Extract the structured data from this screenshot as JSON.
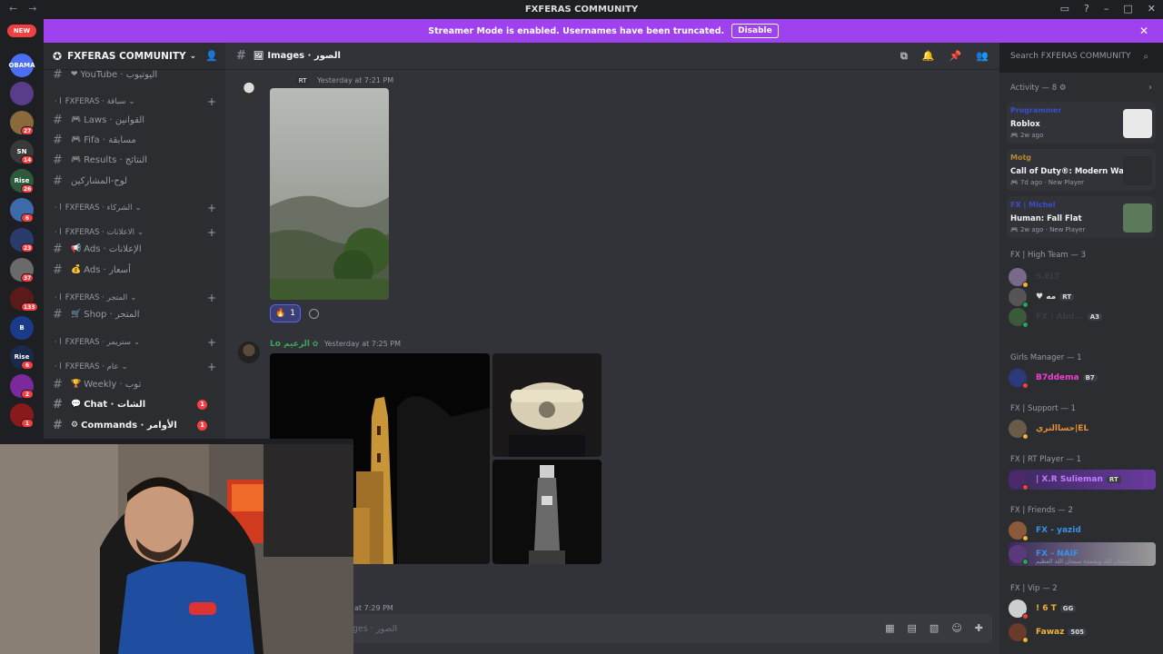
{
  "window": {
    "title": "FXFERAS COMMUNITY"
  },
  "banner": {
    "text": "Streamer Mode is enabled. Usernames have been truncated.",
    "disable_label": "Disable"
  },
  "servers": {
    "new_label": "NEW",
    "items": [
      {
        "name": "OBAMA",
        "color": "#4b6ef2",
        "badge": ""
      },
      {
        "name": "",
        "color": "#5a3d8a",
        "badge": ""
      },
      {
        "name": "",
        "color": "#8a6a3d",
        "badge": "27"
      },
      {
        "name": "SN",
        "color": "#3a3a3a",
        "badge": "14"
      },
      {
        "name": "Rise",
        "color": "#2d5a3d",
        "badge": "26"
      },
      {
        "name": "",
        "color": "#3d6aa8",
        "badge": "6"
      },
      {
        "name": "",
        "color": "#2a3a6a",
        "badge": "23"
      },
      {
        "name": "",
        "color": "#6a6a6a",
        "badge": "37"
      },
      {
        "name": "",
        "color": "#5a1a1a",
        "badge": "133"
      },
      {
        "name": "B",
        "color": "#1a3a8a",
        "badge": ""
      },
      {
        "name": "Rise",
        "color": "#1a2a4a",
        "badge": "6"
      },
      {
        "name": "",
        "color": "#7a2a9a",
        "badge": "2"
      },
      {
        "name": "",
        "color": "#8a1a1a",
        "badge": "1"
      }
    ]
  },
  "sidebar": {
    "guild_name": "FXFERAS COMMUNITY",
    "channels": [
      {
        "type": "channel",
        "emoji": "❤",
        "label": "YouTube · اليوتيوب",
        "bold": false,
        "unread": ""
      },
      {
        "type": "category",
        "label": "FXFERAS · سباقة"
      },
      {
        "type": "channel",
        "emoji": "🎮",
        "label": "Laws · القوانين",
        "bold": false,
        "unread": ""
      },
      {
        "type": "channel",
        "emoji": "🎮",
        "label": "Fifa · مسابقة",
        "bold": false,
        "unread": ""
      },
      {
        "type": "channel",
        "emoji": "🎮",
        "label": "Results · النتائج",
        "bold": false,
        "unread": ""
      },
      {
        "type": "channel",
        "emoji": "",
        "label": "لوح-المشاركين",
        "bold": false,
        "unread": ""
      },
      {
        "type": "category",
        "label": "FXFERAS · الشركاء"
      },
      {
        "type": "category",
        "label": "FXFERAS · الاعلانات"
      },
      {
        "type": "channel",
        "emoji": "📢",
        "label": "Ads · الإعلانات",
        "bold": false,
        "unread": ""
      },
      {
        "type": "channel",
        "emoji": "💰",
        "label": "Ads · أسعار",
        "bold": false,
        "unread": ""
      },
      {
        "type": "category",
        "label": "FXFERAS · المتجر"
      },
      {
        "type": "channel",
        "emoji": "🛒",
        "label": "Shop · المتجر",
        "bold": false,
        "unread": ""
      },
      {
        "type": "category",
        "label": "FXFERAS · ستريمر"
      },
      {
        "type": "category",
        "label": "FXFERAS · عام"
      },
      {
        "type": "channel",
        "emoji": "🏆",
        "label": "Weekly · توب",
        "bold": false,
        "unread": ""
      },
      {
        "type": "channel",
        "emoji": "💬",
        "label": "Chat · الشات",
        "bold": true,
        "unread": "1"
      },
      {
        "type": "channel",
        "emoji": "⚙",
        "label": "Commands · الأوامر",
        "bold": true,
        "unread": "1"
      }
    ]
  },
  "channel": {
    "name": "Images · الصور",
    "emoji": "🖼"
  },
  "search": {
    "placeholder": "Search FXFERAS COMMUNITY"
  },
  "messages": [
    {
      "tag": "RT",
      "time": "Yesterday at 7:21 PM"
    },
    {
      "name": "Lo الزعيم",
      "name_color": "#3ba55c",
      "time": "Yesterday at 7:25 PM"
    },
    {
      "time": "at 7:29 PM"
    }
  ],
  "reaction": {
    "emoji": "🔥",
    "count": "1"
  },
  "composer": {
    "placeholder": "ges · الصور"
  },
  "activity": {
    "title": "Activity — 8",
    "items": [
      {
        "user": "Programmer",
        "user_color": "#3b4ec9",
        "game": "Roblox",
        "time": "2w ago",
        "extra": ""
      },
      {
        "user": "Motg",
        "user_color": "#b58a2d",
        "game": "Call of Duty®: Modern Warf...",
        "time": "7d ago",
        "extra": "New Player"
      },
      {
        "user": "FX | Michel",
        "user_color": "#3b4ec9",
        "game": "Human: Fall Flat",
        "time": "2w ago",
        "extra": "New Player"
      }
    ]
  },
  "groups": [
    {
      "title": "FX | High Team — 3",
      "members": [
        {
          "name": "S.ELT",
          "color": "#3a3c43",
          "badge": "",
          "status": "#f0b232",
          "sub": ""
        },
        {
          "name": "♥ مه",
          "color": "#dbdee1",
          "badge": "RT",
          "status": "#23a55a",
          "sub": ""
        },
        {
          "name": "FX | Abd...",
          "color": "#3a3c43",
          "badge": "A3",
          "status": "#23a55a",
          "sub": ""
        }
      ]
    },
    {
      "title": "Girls Manager — 1",
      "members": [
        {
          "name": "B7ddema",
          "color": "#f13fd0",
          "badge": "B7",
          "status": "#f23f42",
          "sub": ""
        }
      ]
    },
    {
      "title": "FX | Support — 1",
      "members": [
        {
          "name": "حساالنري|EL",
          "color": "#e5903b",
          "badge": "",
          "status": "#f0b232",
          "sub": ""
        }
      ]
    },
    {
      "title": "FX | RT Player — 1",
      "members": [
        {
          "name": "| X.R Sulieman",
          "color": "#c27cff",
          "badge": "RT",
          "status": "#f23f42",
          "sub": ""
        }
      ]
    },
    {
      "title": "FX | Friends — 2",
      "members": [
        {
          "name": "FX - yazid",
          "color": "#3b8fe6",
          "badge": "",
          "status": "#f0b232",
          "sub": ""
        },
        {
          "name": "FX - NAIF",
          "color": "#3b8fe6",
          "badge": "",
          "status": "#23a55a",
          "sub": "سبحان الله وبحمده سبحان الله العظيم"
        }
      ]
    },
    {
      "title": "FX | Vip — 2",
      "members": [
        {
          "name": "! 6 T",
          "color": "#f0b232",
          "badge": "GG",
          "status": "#f23f42",
          "sub": ""
        },
        {
          "name": "Fawaz",
          "color": "#f0b232",
          "badge": "505",
          "status": "#f0b232",
          "sub": ""
        }
      ]
    }
  ]
}
